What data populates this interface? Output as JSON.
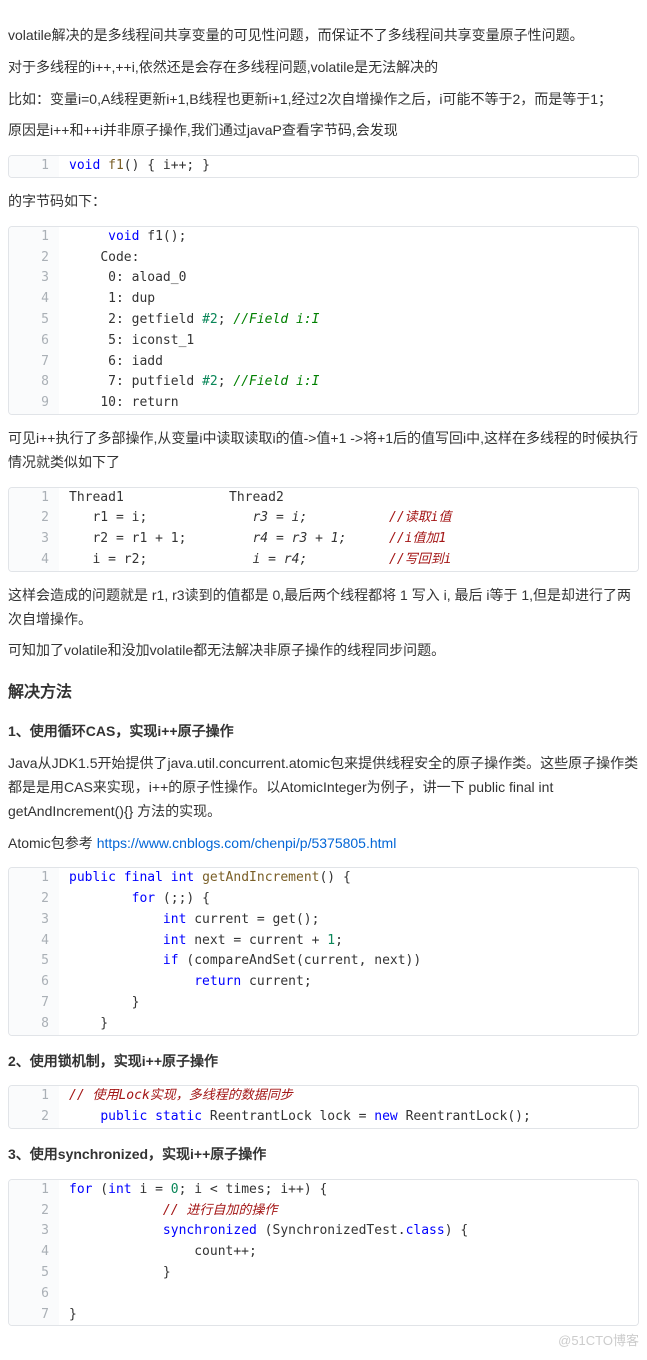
{
  "p1": "volatile解决的是多线程间共享变量的可见性问题，而保证不了多线程间共享变量原子性问题。",
  "p2": "对于多线程的i++,++i,依然还是会存在多线程问题,volatile是无法解决的",
  "p3": "比如：变量i=0,A线程更新i+1,B线程也更新i+1,经过2次自增操作之后，i可能不等于2，而是等于1；",
  "p4": "原因是i++和++i并非原子操作,我们通过javaP查看字节码,会发现",
  "p5": "的字节码如下：",
  "p6": "可见i++执行了多部操作,从变量i中读取读取i的值->值+1 ->将+1后的值写回i中,这样在多线程的时候执行情况就类似如下了",
  "p7": "这样会造成的问题就是 r1, r3读到的值都是 0,最后两个线程都将 1 写入 i, 最后 i等于 1,但是却进行了两次自增操作。",
  "p8": "可知加了volatile和没加volatile都无法解决非原子操作的线程同步问题。",
  "h_solve": "解决方法",
  "s1_title": "1、使用循环CAS，实现i++原子操作",
  "s1_p": "Java从JDK1.5开始提供了java.util.concurrent.atomic包来提供线程安全的原子操作类。这些原子操作类都是是用CAS来实现，i++的原子性操作。以AtomicInteger为例子，讲一下 public final int getAndIncrement(){} 方法的实现。",
  "s1_ref": "Atomic包参考 ",
  "s1_link": "https://www.cnblogs.com/chenpi/p/5375805.html",
  "s2_title": "2、使用锁机制，实现i++原子操作",
  "s3_title": "3、使用synchronized，实现i++原子操作",
  "watermark": "@51CTO博客",
  "code1": {
    "l1": {
      "n": "1",
      "kw1": "void",
      "fn": " f1",
      "rest": "() { i++; }"
    }
  },
  "code2": {
    "l1": {
      "n": "1",
      "pre": "     ",
      "kw": "void",
      "rest": " f1();"
    },
    "l2": {
      "n": "2",
      "pre": "    ",
      "t": "Code:"
    },
    "l3": {
      "n": "3",
      "pre": "     ",
      "t": "0: aload_0"
    },
    "l4": {
      "n": "4",
      "pre": "     ",
      "t": "1: dup"
    },
    "l5": {
      "n": "5",
      "pre": "     ",
      "t1": "2: getfield ",
      "num": "#2",
      "t2": "; ",
      "cm": "//Field i:I"
    },
    "l6": {
      "n": "6",
      "pre": "     ",
      "t": "5: iconst_1"
    },
    "l7": {
      "n": "7",
      "pre": "     ",
      "t": "6: iadd"
    },
    "l8": {
      "n": "8",
      "pre": "     ",
      "t1": "7: putfield ",
      "num": "#2",
      "t2": "; ",
      "cm": "//Field i:I"
    },
    "l9": {
      "n": "9",
      "pre": "    ",
      "t": "10: return"
    }
  },
  "code3": {
    "l1": {
      "n": "1",
      "a": "Thread1",
      "b": "Thread2",
      "c": ""
    },
    "l2": {
      "n": "2",
      "a": "   r1 = i;",
      "b": "   r3 = i;",
      "c": "//读取i值"
    },
    "l3": {
      "n": "3",
      "a": "   r2 = r1 + 1;",
      "b": "   r4 = r3 + 1;",
      "c": "//i值加1"
    },
    "l4": {
      "n": "4",
      "a": "   i = r2;",
      "b": "   i = r4;",
      "c": "//写回到i"
    }
  },
  "code4": {
    "l1": {
      "n": "1",
      "kw1": "public",
      "sp1": " ",
      "kw2": "final",
      "sp2": " ",
      "kw3": "int",
      "sp3": " ",
      "fn": "getAndIncrement",
      "rest": "() {"
    },
    "l2": {
      "n": "2",
      "pre": "        ",
      "kw": "for",
      "rest": " (;;) {"
    },
    "l3": {
      "n": "3",
      "pre": "            ",
      "kw": "int",
      "rest": " current = get();"
    },
    "l4": {
      "n": "4",
      "pre": "            ",
      "kw": "int",
      "t1": " next = current + ",
      "num": "1",
      "t2": ";"
    },
    "l5": {
      "n": "5",
      "pre": "            ",
      "kw": "if",
      "rest": " (compareAndSet(current, next))"
    },
    "l6": {
      "n": "6",
      "pre": "                ",
      "kw": "return",
      "rest": " current;"
    },
    "l7": {
      "n": "7",
      "pre": "        }",
      "rest": ""
    },
    "l8": {
      "n": "8",
      "pre": "    }",
      "rest": ""
    }
  },
  "code5": {
    "l1": {
      "n": "1",
      "cm": "// 使用Lock实现，多线程的数据同步"
    },
    "l2": {
      "n": "2",
      "pre": "    ",
      "kw1": "public",
      "sp1": " ",
      "kw2": "static",
      "sp2": " ",
      "t1": "ReentrantLock lock = ",
      "kw3": "new",
      "t2": " ReentrantLock();"
    }
  },
  "code6": {
    "l1": {
      "n": "1",
      "kw1": "for",
      "t1": " (",
      "kw2": "int",
      "t2": " i = ",
      "n1": "0",
      "t3": "; i < times; i++) {"
    },
    "l2": {
      "n": "2",
      "pre": "            ",
      "cm": "// 进行自加的操作"
    },
    "l3": {
      "n": "3",
      "pre": "            ",
      "kw": "synchronized",
      "t1": " (SynchronizedTest.",
      "kw2": "class",
      "t2": ") {"
    },
    "l4": {
      "n": "4",
      "pre": "                count++;"
    },
    "l5": {
      "n": "5",
      "pre": "            }"
    },
    "l6": {
      "n": "6",
      "pre": ""
    },
    "l7": {
      "n": "7",
      "pre": "}"
    }
  }
}
